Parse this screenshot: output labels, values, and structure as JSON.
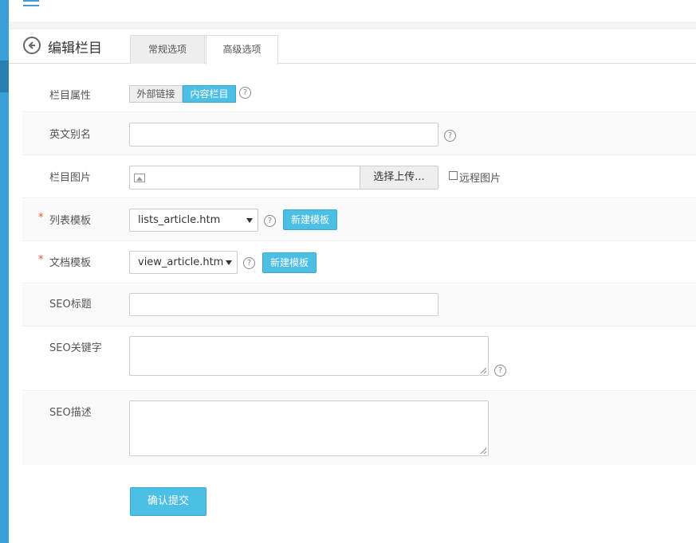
{
  "header": {
    "title": "编辑栏目",
    "tabs": [
      {
        "label": "常规选项",
        "active": false
      },
      {
        "label": "高级选项",
        "active": true
      }
    ]
  },
  "form": {
    "attr": {
      "label": "栏目属性",
      "options": [
        "外部链接",
        "内容栏目"
      ],
      "selected": "内容栏目"
    },
    "alias": {
      "label": "英文别名",
      "value": ""
    },
    "image": {
      "label": "栏目图片",
      "upload_label": "选择上传...",
      "remote_label": "远程图片",
      "remote_checked": false
    },
    "list_tpl": {
      "label": "列表模板",
      "required": "*",
      "value": "lists_article.htm",
      "new_label": "新建模板"
    },
    "doc_tpl": {
      "label": "文档模板",
      "required": "*",
      "value": "view_article.htm",
      "new_label": "新建模板"
    },
    "seo_title": {
      "label": "SEO标题",
      "value": ""
    },
    "seo_keywords": {
      "label": "SEO关键字",
      "value": ""
    },
    "seo_desc": {
      "label": "SEO描述",
      "value": ""
    },
    "help_glyph": "?",
    "submit_label": "确认提交"
  },
  "colors": {
    "accent": "#4cbfe4",
    "sidebar": "#3a9fd6",
    "required": "#e8561f"
  }
}
